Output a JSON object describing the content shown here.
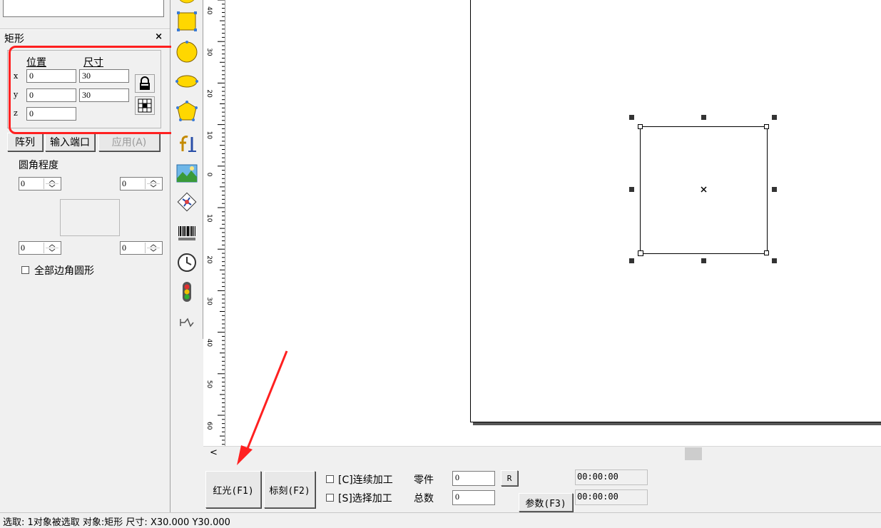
{
  "panel": {
    "title": "矩形",
    "close": "×",
    "position_header": "位置",
    "size_header": "尺寸",
    "x_label": "x",
    "y_label": "y",
    "z_label": "z",
    "pos_x": "0",
    "pos_y": "0",
    "pos_z": "0",
    "size_x": "30",
    "size_y": "30",
    "array_btn": "阵列",
    "input_port_btn": "输入端口",
    "apply_btn": "应用(A)",
    "corner_label": "圆角程度",
    "corner_tl": "0",
    "corner_tr": "0",
    "corner_bl": "0",
    "corner_br": "0",
    "all_corners_label": "全部边角圆形"
  },
  "ruler": {
    "labels": [
      "40",
      "30",
      "20",
      "10",
      "0",
      "10",
      "20",
      "30",
      "40",
      "50",
      "60"
    ]
  },
  "scroll": {
    "left_arrow": "<"
  },
  "bottom": {
    "red_light_btn": "红光(F1)",
    "mark_btn": "标刻(F2)",
    "continuous_label": "[C]连续加工",
    "select_label": "[S]选择加工",
    "parts_label": "零件",
    "total_label": "总数",
    "parts_value": "0",
    "total_value": "0",
    "r_btn": "R",
    "params_btn": "参数(F3)",
    "time1": "00:00:00",
    "time2": "00:00:00"
  },
  "status": {
    "text": "选取: 1对象被选取 对象:矩形 尺寸: X30.000 Y30.000"
  },
  "colors": {
    "highlight": "#ff2020",
    "shape_fill": "#ffd700"
  }
}
